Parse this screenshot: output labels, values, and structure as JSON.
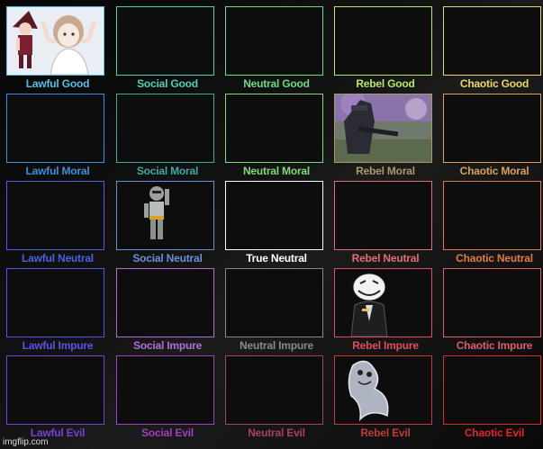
{
  "chart": {
    "rows": [
      [
        {
          "label": "Lawful Good",
          "color": "#59bfe6",
          "occupant": "two-characters-icon"
        },
        {
          "label": "Social Good",
          "color": "#4fd2b3",
          "occupant": ""
        },
        {
          "label": "Neutral Good",
          "color": "#6fdc84",
          "occupant": ""
        },
        {
          "label": "Rebel Good",
          "color": "#b8e86a",
          "occupant": ""
        },
        {
          "label": "Chaotic Good",
          "color": "#ecd86a",
          "occupant": ""
        }
      ],
      [
        {
          "label": "Lawful Moral",
          "color": "#3f8fd8",
          "occupant": ""
        },
        {
          "label": "Social Moral",
          "color": "#3fa9a6",
          "occupant": ""
        },
        {
          "label": "Neutral Moral",
          "color": "#7fdb7a",
          "occupant": ""
        },
        {
          "label": "Rebel Moral",
          "color": "#a89a6a",
          "occupant": "armored-soldier-icon"
        },
        {
          "label": "Chaotic Moral",
          "color": "#d9a15a",
          "occupant": ""
        }
      ],
      [
        {
          "label": "Lawful Neutral",
          "color": "#4a62e0",
          "occupant": ""
        },
        {
          "label": "Social Neutral",
          "color": "#6b8fd9",
          "occupant": "robot-figure-icon"
        },
        {
          "label": "True Neutral",
          "color": "#ffffff",
          "occupant": ""
        },
        {
          "label": "Rebel Neutral",
          "color": "#e26f6f",
          "occupant": ""
        },
        {
          "label": "Chaotic Neutral",
          "color": "#e0784e",
          "occupant": ""
        }
      ],
      [
        {
          "label": "Lawful Impure",
          "color": "#5a53e8",
          "occupant": ""
        },
        {
          "label": "Social Impure",
          "color": "#b06fd9",
          "occupant": ""
        },
        {
          "label": "Neutral Impure",
          "color": "#8a8a8a",
          "occupant": ""
        },
        {
          "label": "Rebel Impure",
          "color": "#e04e5e",
          "occupant": "trollface-suit-icon"
        },
        {
          "label": "Chaotic Impure",
          "color": "#d95f6a",
          "occupant": ""
        }
      ],
      [
        {
          "label": "Lawful Evil",
          "color": "#7b3fd9",
          "occupant": ""
        },
        {
          "label": "Social Evil",
          "color": "#a03fc0",
          "occupant": ""
        },
        {
          "label": "Neutral Evil",
          "color": "#a8405f",
          "occupant": ""
        },
        {
          "label": "Rebel Evil",
          "color": "#c23a3a",
          "occupant": "ghost-creature-icon"
        },
        {
          "label": "Chaotic Evil",
          "color": "#e0262c",
          "occupant": ""
        }
      ]
    ]
  },
  "watermark": "imgflip.com"
}
